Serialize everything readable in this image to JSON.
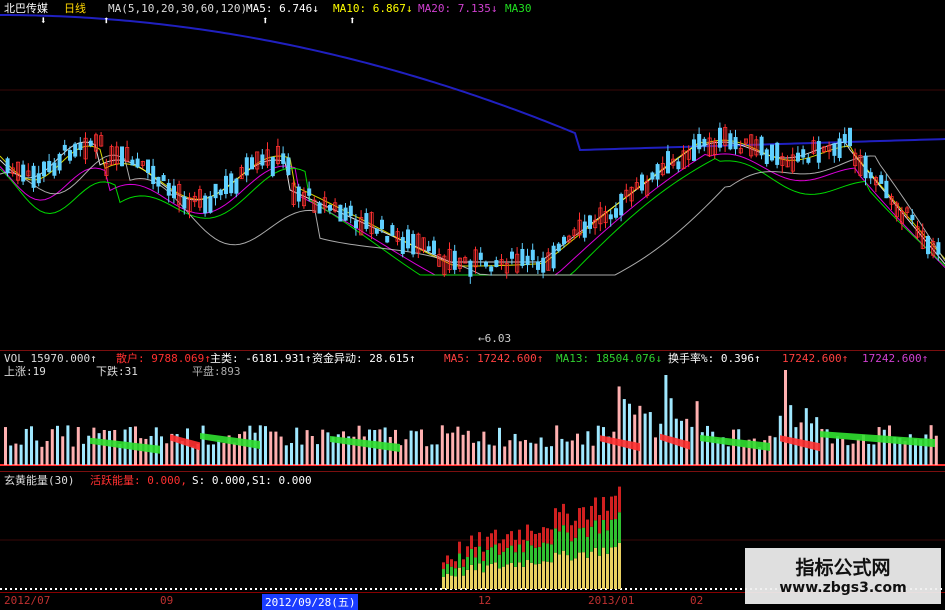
{
  "price": {
    "stock_name": "北巴传媒",
    "period": "日线",
    "ma_label": "MA(5,10,20,30,60,120)",
    "ma5": "MA5: 6.746↓",
    "ma10": "MA10: 6.867↓",
    "ma20": "MA20: 7.135↓",
    "ma30": "MA30",
    "low_marker": "6.03",
    "colors": {
      "ma5": "#ffffff",
      "ma10": "#ffff00",
      "ma20": "#ff00ff",
      "ma30": "#00ff00",
      "up": "#ff3030",
      "down": "#60d0ff",
      "long": "#2020c0"
    }
  },
  "volume": {
    "vol": "VOL 15970.000↑",
    "sanhu": "散户: 9788.069↑",
    "zhuli": "主类: -6181.931↑",
    "zijin": "资金异动: 28.615↑",
    "ma5": "MA5: 17242.600↑",
    "ma13": "MA13: 18504.076↓",
    "turnover": "换手率%: 0.396↑",
    "v1": "17242.600↑",
    "v2": "17242.600↑",
    "up_count": "上涨:19",
    "down_count": "下跌:31",
    "flat_count": "平盘:893"
  },
  "energy": {
    "label": "玄黄能量(30)",
    "active": "活跃能量: 0.000,",
    "s": "S: 0.000,",
    "s1": "S1: 0.000"
  },
  "dates": [
    "2012/07",
    "09",
    "2012/09/28(五)",
    "12",
    "2013/01",
    "02"
  ],
  "watermark": {
    "title": "指标公式网",
    "url": "www.zbgs3.com"
  }
}
